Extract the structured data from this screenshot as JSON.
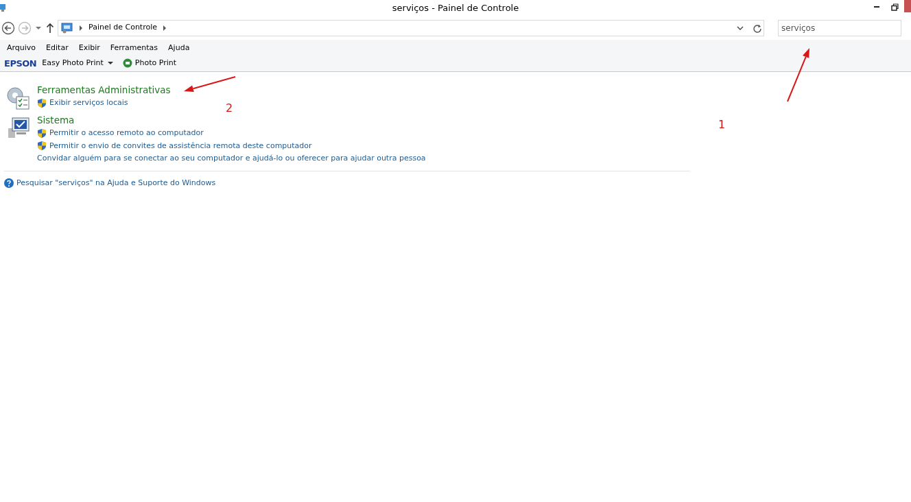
{
  "window": {
    "title": "serviços - Painel de Controle"
  },
  "address_bar": {
    "path": [
      "Painel de Controle"
    ]
  },
  "search": {
    "value": "serviços"
  },
  "menu": [
    "Arquivo",
    "Editar",
    "Exibir",
    "Ferramentas",
    "Ajuda"
  ],
  "toolbar": {
    "brand": "EPSON",
    "items": [
      {
        "label": "Easy Photo Print",
        "kind": "dropdown"
      },
      {
        "label": "Photo Print",
        "kind": "printer"
      }
    ]
  },
  "results": [
    {
      "title": "Ferramentas Administrativas",
      "kind": "tools",
      "links": [
        {
          "label": "Exibir serviços locais",
          "kind": "shield"
        }
      ]
    },
    {
      "title": "Sistema",
      "kind": "system",
      "links": [
        {
          "label": "Permitir o acesso remoto ao computador",
          "kind": "shield"
        },
        {
          "label": "Permitir o envio de convites de assistência remota deste computador",
          "kind": "shield"
        },
        {
          "label": "Convidar alguém para se conectar ao seu computador e ajudá-lo ou oferecer para ajudar outra pessoa",
          "kind": "plain"
        }
      ]
    }
  ],
  "help_link": "Pesquisar \"serviços\" na Ajuda e Suporte do Windows",
  "annotations": [
    {
      "label": "1"
    },
    {
      "label": "2"
    }
  ]
}
